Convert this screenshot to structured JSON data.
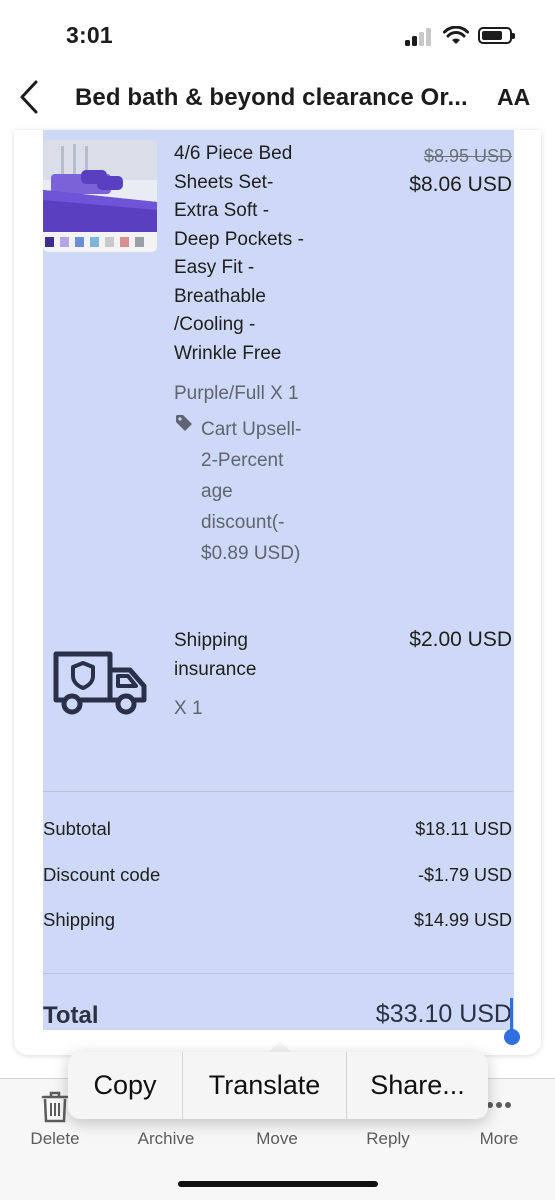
{
  "status_bar": {
    "time": "3:01"
  },
  "header": {
    "title": "Bed bath & beyond clearance Or...",
    "text_size": "AA"
  },
  "order": {
    "item": {
      "title_lines": [
        "4/6 Piece Bed",
        "Sheets Set-",
        "Extra Soft -",
        "Deep Pockets -",
        "Easy Fit -",
        "Breathable",
        "/Cooling -",
        "Wrinkle Free"
      ],
      "variant": "Purple/Full X 1",
      "discount_lines": [
        "Cart Upsell-",
        "2-Percent",
        "age",
        "discount(-",
        "$0.89 USD)"
      ],
      "original_price": "$8.95 USD",
      "price": "$8.06 USD"
    },
    "shipping_insurance": {
      "title_lines": [
        "Shipping",
        "insurance"
      ],
      "qty": "X 1",
      "price": "$2.00 USD"
    },
    "summary": [
      {
        "label": "Subtotal",
        "value": "$18.11 USD"
      },
      {
        "label": "Discount code",
        "value": "-$1.79 USD"
      },
      {
        "label": "Shipping",
        "value": "$14.99 USD"
      }
    ],
    "total": {
      "label": "Total",
      "value": "$33.10 USD"
    }
  },
  "context_menu": {
    "copy": "Copy",
    "translate": "Translate",
    "share": "Share..."
  },
  "toolbar": {
    "delete": "Delete",
    "archive": "Archive",
    "move": "Move",
    "reply": "Reply",
    "more": "More"
  },
  "colors": {
    "selection": "#cdd9f6",
    "accent": "#2f6fe0",
    "sheet_purple": "#5a3fc0"
  }
}
